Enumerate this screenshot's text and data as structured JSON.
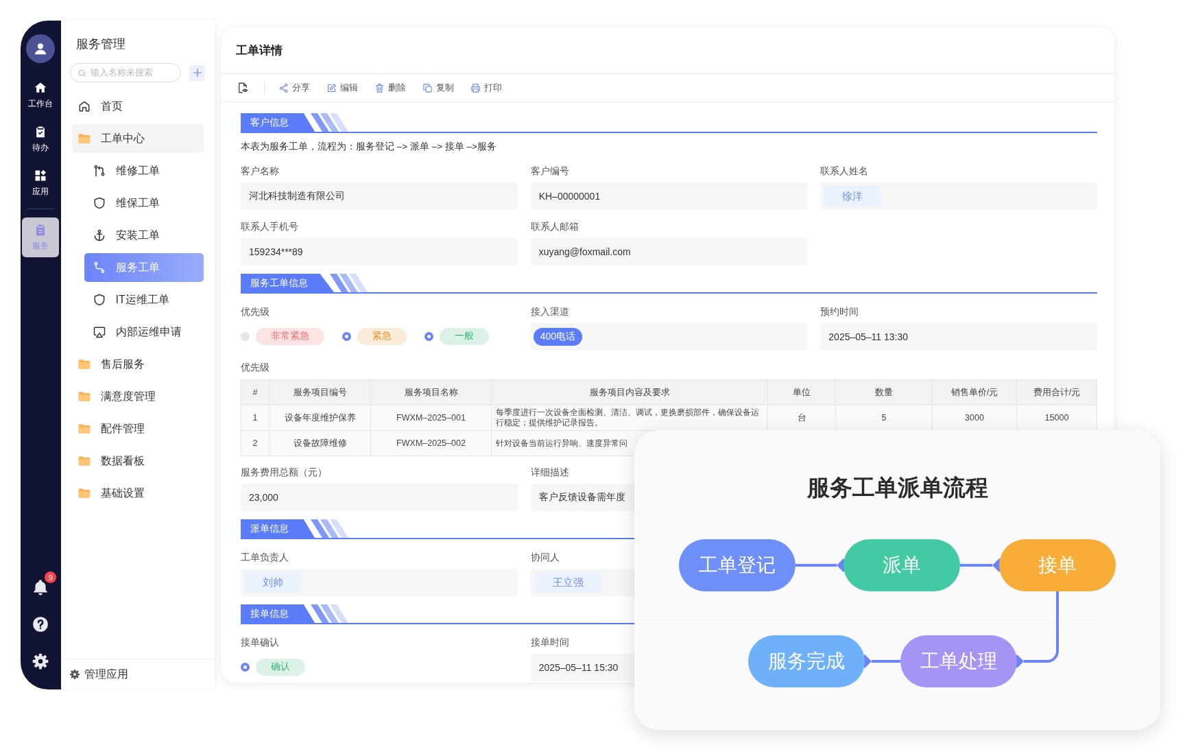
{
  "rail": {
    "items": [
      {
        "label": "工作台",
        "selected": false
      },
      {
        "label": "待办",
        "selected": false
      },
      {
        "label": "应用",
        "selected": false
      },
      {
        "label": "服务",
        "selected": true
      }
    ],
    "notification_badge": "9"
  },
  "sidebar": {
    "title": "服务管理",
    "search": {
      "placeholder": "输入名称来搜索"
    },
    "items": [
      {
        "label": "首页",
        "kind": "page",
        "selected": false
      },
      {
        "label": "工单中心",
        "kind": "folder",
        "selected": false,
        "children": [
          {
            "label": "维修工单",
            "kind": "page",
            "selected": false
          },
          {
            "label": "维保工单",
            "kind": "page",
            "selected": false
          },
          {
            "label": "安装工单",
            "kind": "page",
            "selected": false
          },
          {
            "label": "服务工单",
            "kind": "page",
            "selected": true
          },
          {
            "label": "IT运维工单",
            "kind": "page",
            "selected": false
          },
          {
            "label": "内部运维申请",
            "kind": "page",
            "selected": false
          }
        ]
      },
      {
        "label": "售后服务",
        "kind": "folder",
        "selected": false
      },
      {
        "label": "满意度管理",
        "kind": "folder",
        "selected": false
      },
      {
        "label": "配件管理",
        "kind": "folder",
        "selected": false
      },
      {
        "label": "数据看板",
        "kind": "folder",
        "selected": false
      },
      {
        "label": "基础设置",
        "kind": "folder",
        "selected": false
      }
    ],
    "footer": "管理应用"
  },
  "detail": {
    "title": "工单详情",
    "toolbar": [
      "分享",
      "编辑",
      "删除",
      "复制",
      "打印"
    ],
    "sections": [
      {
        "title": "客户信息",
        "blocks": [
          {
            "kind": "note",
            "text": "本表为服务工单，流程为：服务登记 –> 派单 –> 接单 –>服务"
          },
          {
            "kind": "fields",
            "fields": [
              {
                "label": "客户名称",
                "kind": "text",
                "value": "河北科技制造有限公司"
              },
              {
                "label": "客户编号",
                "kind": "text",
                "value": "KH–00000001"
              },
              {
                "label": "联系人姓名",
                "kind": "person",
                "value": "徐洋"
              },
              {
                "label": "联系人手机号",
                "kind": "text",
                "value": "159234***89"
              },
              {
                "label": "联系人邮箱",
                "kind": "text",
                "value": "xuyang@foxmail.com"
              }
            ]
          }
        ]
      },
      {
        "title": "服务工单信息",
        "blocks": [
          {
            "kind": "fields",
            "fields": [
              {
                "label": "优先级",
                "kind": "options",
                "options": [
                  {
                    "label": "非常紧急",
                    "checked": false,
                    "color": "#f56c6c"
                  },
                  {
                    "label": "紧急",
                    "checked": true,
                    "color": "#e6962e"
                  },
                  {
                    "label": "一般",
                    "checked": true,
                    "color": "#3cb878"
                  }
                ]
              },
              {
                "label": "接入渠道",
                "kind": "chip",
                "value": "400电话"
              },
              {
                "label": "预约时间",
                "kind": "text",
                "value": "2025–05–11 13:30"
              }
            ]
          },
          {
            "kind": "table",
            "caption": "优先级",
            "columns": [
              "#",
              "服务项目编号",
              "服务项目名称",
              "服务项目内容及要求",
              "单位",
              "数量",
              "销售单价/元",
              "费用合计/元"
            ],
            "rows": [
              [
                "1",
                "设备年度维护保养",
                "FWXM–2025–001",
                "每季度进行一次设备全面检测、清洁、调试，更换磨损部件，确保设备运行稳定；提供维护记录报告。",
                "台",
                "5",
                "3000",
                "15000"
              ],
              [
                "2",
                "设备故障维修",
                "FWXM–2025–002",
                "针对设备当前运行异响、速度异常问"
              ]
            ]
          },
          {
            "kind": "fields",
            "fields": [
              {
                "label": "服务费用总额（元）",
                "kind": "text",
                "value": "23,000"
              },
              {
                "label": "详细描述",
                "kind": "text",
                "value": "客户反馈设备需年度"
              }
            ]
          }
        ]
      },
      {
        "title": "派单信息",
        "blocks": [
          {
            "kind": "fields",
            "fields": [
              {
                "label": "工单负责人",
                "kind": "person",
                "value": "刘帅"
              },
              {
                "label": "协同人",
                "kind": "person",
                "value": "王立强"
              }
            ]
          }
        ]
      },
      {
        "title": "接单信息",
        "blocks": [
          {
            "kind": "fields",
            "fields": [
              {
                "label": "接单确认",
                "kind": "options",
                "options": [
                  {
                    "label": "确认",
                    "checked": true,
                    "color": "#3cb878"
                  }
                ]
              },
              {
                "label": "接单时间",
                "kind": "text",
                "value": "2025–05–11 15:30"
              }
            ]
          }
        ]
      }
    ]
  },
  "flow_card": {
    "title": "服务工单派单流程",
    "nodes": [
      {
        "label": "工单登记",
        "color": "#6f8ff8"
      },
      {
        "label": "派单",
        "color": "#43c9a3"
      },
      {
        "label": "接单",
        "color": "#f8ad38"
      },
      {
        "label": "工单处理",
        "color": "#a594f4"
      },
      {
        "label": "服务完成",
        "color": "#6fb0fb"
      }
    ]
  }
}
